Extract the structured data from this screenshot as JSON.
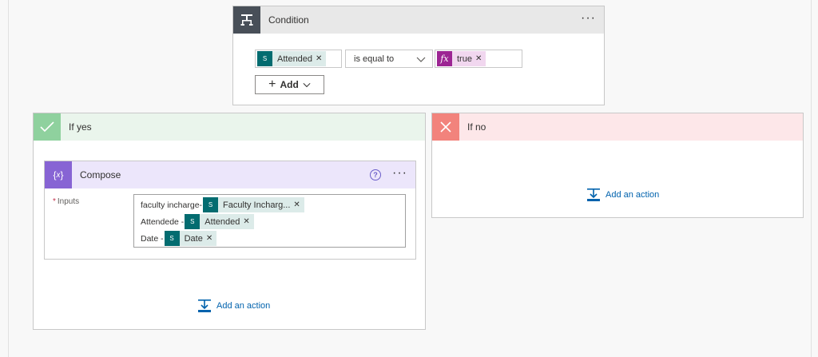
{
  "condition": {
    "title": "Condition",
    "more": "···",
    "left_token": "Attended",
    "operator": "is equal to",
    "right_token": "true",
    "right_icon": "fx",
    "add_label": "Add"
  },
  "if_yes": {
    "title": "If yes",
    "add_action": "Add an action",
    "compose": {
      "title": "Compose",
      "more": "···",
      "help": "?",
      "inputs_label": "Inputs",
      "required_mark": "*",
      "lines": [
        {
          "text": "faculty incharge-",
          "token": "Faculty Incharg..."
        },
        {
          "text": "Attendede -",
          "token": "Attended"
        },
        {
          "text": "Date -",
          "token": "Date"
        }
      ]
    }
  },
  "if_no": {
    "title": "If no",
    "add_action": "Add an action"
  },
  "colors": {
    "sharepoint": "#036c70",
    "expression": "#9c2593",
    "compose": "#8764d4",
    "yes": "#8fd19e",
    "no": "#f2837c",
    "link": "#0062ad"
  }
}
